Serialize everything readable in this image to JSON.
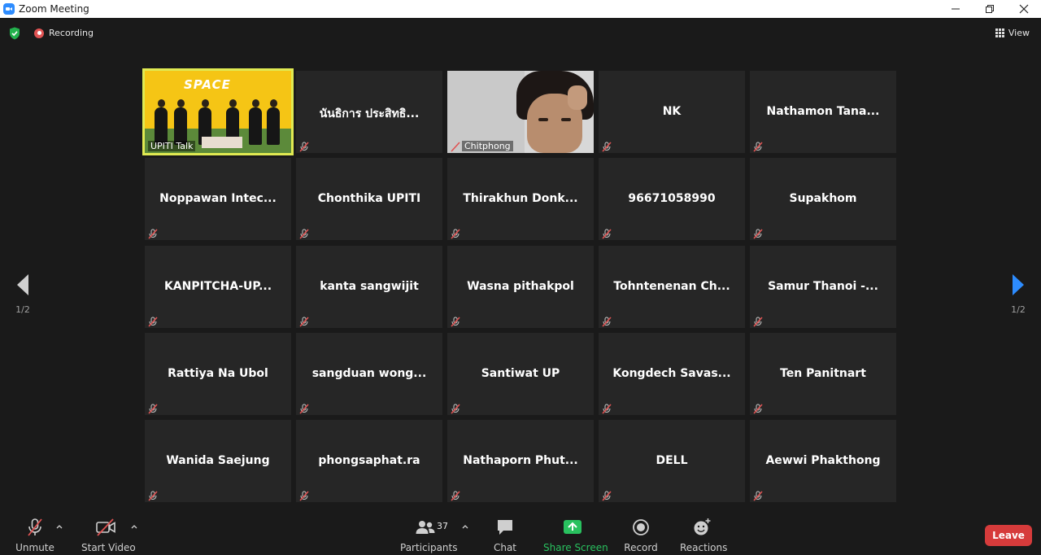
{
  "window": {
    "title": "Zoom Meeting"
  },
  "topbar": {
    "recording_label": "Recording",
    "view_label": "View"
  },
  "grid": {
    "tiles": [
      {
        "name": "UPITI Talk",
        "type": "video-stage",
        "active": true
      },
      {
        "name": "นันธิการ ประสิทธิ...",
        "type": "name"
      },
      {
        "name": "Chitphong",
        "type": "video-face"
      },
      {
        "name": "NK",
        "type": "name"
      },
      {
        "name": "Nathamon Tana...",
        "type": "name"
      },
      {
        "name": "Noppawan Intec...",
        "type": "name"
      },
      {
        "name": "Chonthika UPITI",
        "type": "name"
      },
      {
        "name": "Thirakhun Donk...",
        "type": "name"
      },
      {
        "name": "96671058990",
        "type": "name"
      },
      {
        "name": "Supakhom",
        "type": "name"
      },
      {
        "name": "KANPITCHA-UP...",
        "type": "name"
      },
      {
        "name": "kanta sangwijit",
        "type": "name"
      },
      {
        "name": "Wasna pithakpol",
        "type": "name"
      },
      {
        "name": "Tohntenenan Ch...",
        "type": "name"
      },
      {
        "name": "Samur Thanoi -...",
        "type": "name"
      },
      {
        "name": "Rattiya Na Ubol",
        "type": "name"
      },
      {
        "name": "sangduan wong...",
        "type": "name"
      },
      {
        "name": "Santiwat UP",
        "type": "name"
      },
      {
        "name": "Kongdech Savas...",
        "type": "name"
      },
      {
        "name": "Ten Panitnart",
        "type": "name"
      },
      {
        "name": "Wanida Saejung",
        "type": "name"
      },
      {
        "name": "phongsaphat.ra",
        "type": "name"
      },
      {
        "name": "Nathaporn Phut...",
        "type": "name"
      },
      {
        "name": "DELL",
        "type": "name"
      },
      {
        "name": "Aewwi Phakthong",
        "type": "name"
      }
    ],
    "stage_logo": "SPACE"
  },
  "nav": {
    "left_page": "1/2",
    "right_page": "1/2"
  },
  "toolbar": {
    "unmute_label": "Unmute",
    "start_video_label": "Start Video",
    "participants_label": "Participants",
    "participants_count": "37",
    "chat_label": "Chat",
    "share_label": "Share Screen",
    "record_label": "Record",
    "reactions_label": "Reactions",
    "leave_label": "Leave"
  },
  "colors": {
    "accent_blue": "#2d8cff",
    "active_speaker": "#e0ea52",
    "muted_red": "#e05353",
    "share_green": "#29c15f",
    "leave_red": "#d63b3b"
  }
}
